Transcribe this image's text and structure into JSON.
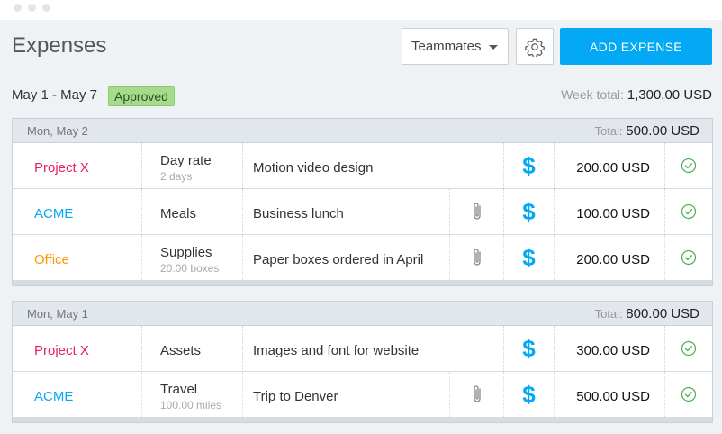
{
  "header": {
    "title": "Expenses",
    "teammates_label": "Teammates",
    "add_expense_label": "ADD EXPENSE"
  },
  "summary": {
    "range": "May 1 - May 7",
    "status_badge": "Approved",
    "week_total_label": "Week total:",
    "week_total_value": "1,300.00 USD"
  },
  "colors": {
    "accent": "#03a9f4",
    "approved": "#a6db8b",
    "project_x": "#e91e63",
    "acme": "#03a9f4",
    "office": "#ff9800",
    "check": "#4caf50"
  },
  "days": [
    {
      "date": "Mon, May 2",
      "total_label": "Total:",
      "total_value": "500.00 USD",
      "rows": [
        {
          "project": "Project X",
          "project_color": "#e91e63",
          "category": "Day rate",
          "category_sub": "2 days",
          "description": "Motion video design",
          "attachment": false,
          "billable_icon": "$",
          "amount": "200.00 USD",
          "status_icon": "check-circle-icon"
        },
        {
          "project": "ACME",
          "project_color": "#03a9f4",
          "category": "Meals",
          "category_sub": "",
          "description": "Business lunch",
          "attachment": true,
          "billable_icon": "$",
          "amount": "100.00 USD",
          "status_icon": "check-circle-icon"
        },
        {
          "project": "Office",
          "project_color": "#ff9800",
          "category": "Supplies",
          "category_sub": "20.00 boxes",
          "description": "Paper boxes ordered in April",
          "attachment": true,
          "billable_icon": "$",
          "amount": "200.00 USD",
          "status_icon": "check-circle-icon"
        }
      ]
    },
    {
      "date": "Mon, May 1",
      "total_label": "Total:",
      "total_value": "800.00 USD",
      "rows": [
        {
          "project": "Project X",
          "project_color": "#e91e63",
          "category": "Assets",
          "category_sub": "",
          "description": "Images and font for website",
          "attachment": false,
          "billable_icon": "$",
          "amount": "300.00 USD",
          "status_icon": "check-circle-icon"
        },
        {
          "project": "ACME",
          "project_color": "#03a9f4",
          "category": "Travel",
          "category_sub": "100.00 miles",
          "description": "Trip to Denver",
          "attachment": true,
          "billable_icon": "$",
          "amount": "500.00 USD",
          "status_icon": "check-circle-icon"
        }
      ]
    }
  ]
}
